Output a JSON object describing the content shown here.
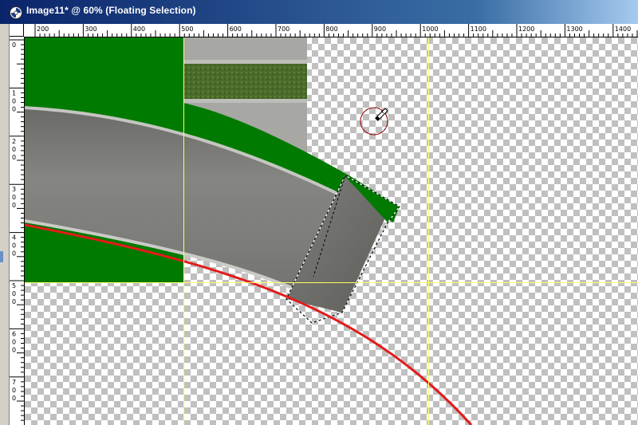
{
  "window": {
    "title": "Image11* @  60% (Floating Selection)",
    "icon": "paint-shop-pro-app-icon"
  },
  "hruler": {
    "labels": [
      "200",
      "300",
      "400",
      "500",
      "600",
      "700",
      "800",
      "900",
      "1000",
      "1100",
      "1200",
      "1300",
      "1400"
    ]
  },
  "vruler": {
    "labels": [
      [
        "0"
      ],
      [
        "1",
        "0",
        "0"
      ],
      [
        "2",
        "0",
        "0"
      ],
      [
        "3",
        "0",
        "0"
      ],
      [
        "4",
        "0",
        "0"
      ],
      [
        "5",
        "0",
        "0"
      ],
      [
        "6",
        "0",
        "0"
      ],
      [
        "7",
        "0",
        "0"
      ]
    ]
  },
  "canvas": {
    "zoom_percent": 60,
    "background": "transparency-checkerboard",
    "layer_colors": {
      "grass": "#007a00",
      "road": "#7a7a76",
      "curb": "#bcbcb8",
      "guide": "#ffff66",
      "path": "#e21b1b"
    },
    "cursor": "brush-cursor-icon",
    "selection": "floating-selection-marquee"
  }
}
